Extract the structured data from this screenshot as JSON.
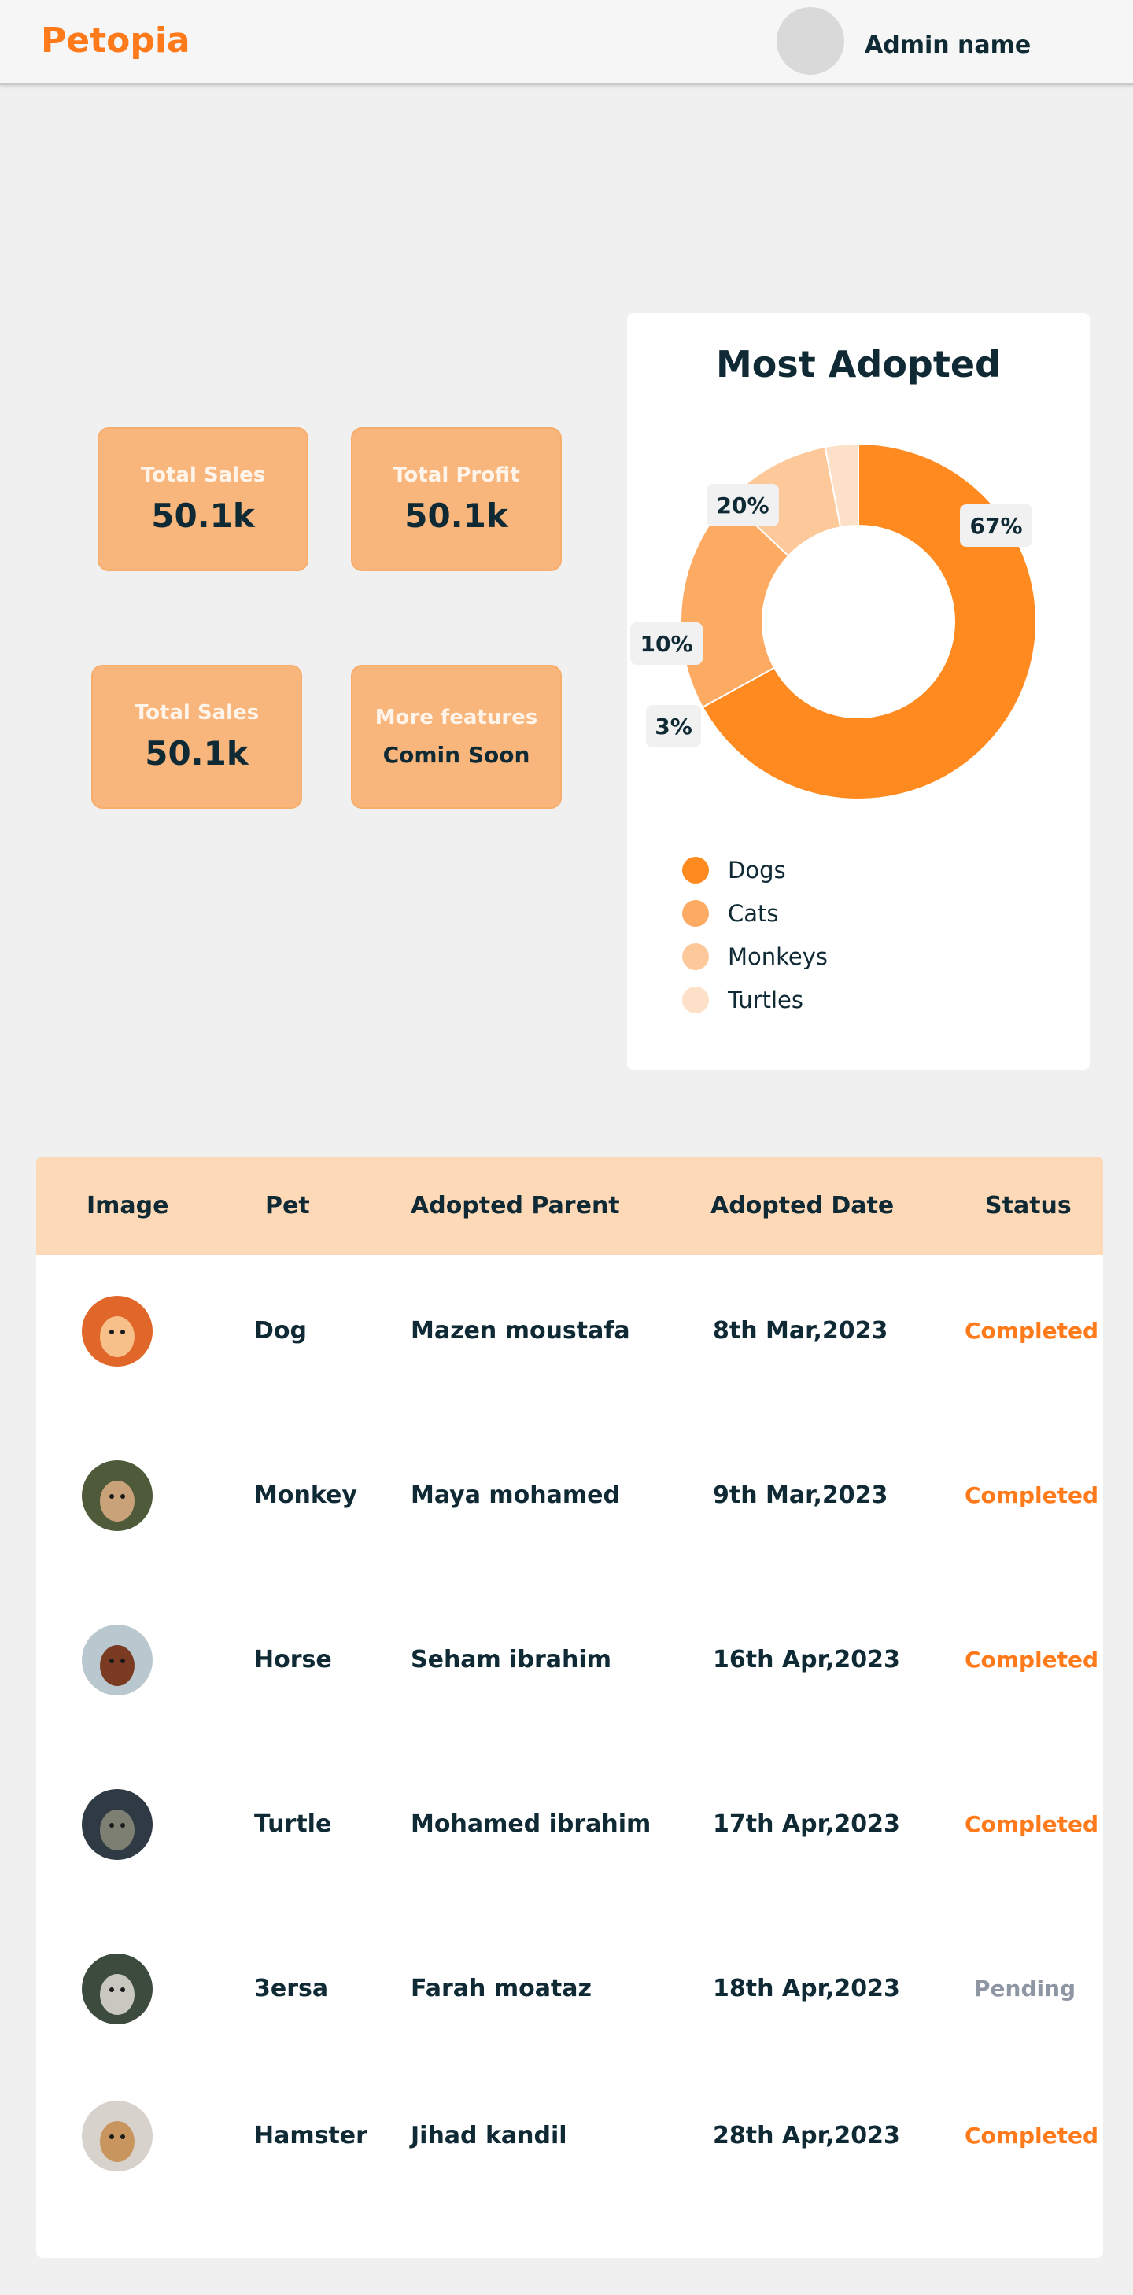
{
  "header": {
    "brand": "Petopia",
    "admin_name": "Admin name"
  },
  "cards": [
    {
      "label": "Total Sales",
      "value": "50.1k"
    },
    {
      "label": "Total Profit",
      "value": "50.1k"
    },
    {
      "label": "Total Sales",
      "value": "50.1k"
    },
    {
      "label": "More features",
      "value": "Comin Soon"
    }
  ],
  "chart_data": {
    "type": "pie",
    "title": "Most Adopted",
    "categories": [
      "Dogs",
      "Cats",
      "Monkeys",
      "Turtles"
    ],
    "values": [
      67,
      20,
      10,
      3
    ],
    "labels": [
      "67%",
      "20%",
      "10%",
      "3%"
    ],
    "colors": [
      "#ff8a20",
      "#fdaa62",
      "#fdc89a",
      "#fde0c8"
    ],
    "legend": "bottom"
  },
  "table": {
    "headers": [
      "Image",
      "Pet",
      "Adopted Parent",
      "Adopted Date",
      "Status"
    ],
    "rows": [
      {
        "image": "corgi-photo",
        "pet": "Dog",
        "parent": "Mazen moustafa",
        "date": "8th Mar,2023",
        "status": "Completed"
      },
      {
        "image": "monkey-photo",
        "pet": "Monkey",
        "parent": "Maya mohamed",
        "date": "9th Mar,2023",
        "status": "Completed"
      },
      {
        "image": "horse-photo",
        "pet": "Horse",
        "parent": "Seham ibrahim",
        "date": "16th Apr,2023",
        "status": "Completed"
      },
      {
        "image": "turtle-photo",
        "pet": "Turtle",
        "parent": "Mohamed ibrahim",
        "date": "17th Apr,2023",
        "status": "Completed"
      },
      {
        "image": "cat-photo",
        "pet": "3ersa",
        "parent": "Farah moataz",
        "date": "18th Apr,2023",
        "status": "Pending"
      },
      {
        "image": "hamster-photo",
        "pet": "Hamster",
        "parent": "Jihad kandil",
        "date": "28th Apr,2023",
        "status": "Completed"
      }
    ]
  }
}
